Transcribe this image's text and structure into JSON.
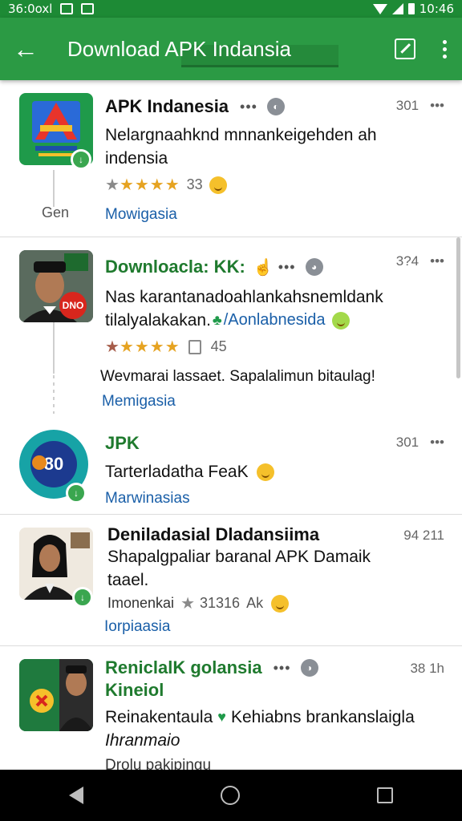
{
  "status_bar": {
    "time_left": "36:0oxl",
    "time_right": "10:46"
  },
  "app_bar": {
    "title": "Download APK Indansia",
    "back_icon": "arrow-left-icon",
    "edit_icon": "edit-square-icon",
    "more_icon": "more-vertical-icon"
  },
  "items": [
    {
      "name": "APK Indanesia",
      "dots": "•••",
      "meta": "301",
      "meta_dots": "•••",
      "description_lines": [
        "Nelargnaahknd mnnankeigehden ah",
        "indensia"
      ],
      "rating_count": "33",
      "side_label": "Gen",
      "link": "Mowigasia"
    },
    {
      "name": "Downloacla: KK:",
      "dots": "•••",
      "meta": "3?4",
      "meta_dots": "•••",
      "description_lines": [
        "Nas karantanadoahlankahsnemldank",
        "tilalyalakakan."
      ],
      "description_link": "/Aonlabnesida",
      "rating_count": "45",
      "extra_line": "Wevmarai lassaet. Sapalalimun bitaulag!",
      "link": "Memigasia",
      "icon_text": "DNO"
    },
    {
      "name": "JPK",
      "meta": "301",
      "meta_dots": "•••",
      "description_lines": [
        "Tarterladatha FeaK"
      ],
      "link": "Marwinasias",
      "icon_text": "80"
    },
    {
      "name": "Deniladasial Dladansiima",
      "meta": "94 211",
      "description_lines": [
        "Shapalgpaliar baranal APK Damaik",
        "taael."
      ],
      "stats_prefix": "Imonenkai",
      "stats_value": "31316",
      "stats_suffix": "Ak",
      "link": "Iorpiaasia"
    },
    {
      "name": "ReniclalK golansia",
      "name_line2": "Kineiol",
      "dots": "•••",
      "meta": "38 1h",
      "description_lines": [
        "Reinakentaula",
        "Kehiabns brankanslaigla",
        "Ihranmaio"
      ],
      "partial_line": "Drolu pakipingu"
    }
  ]
}
